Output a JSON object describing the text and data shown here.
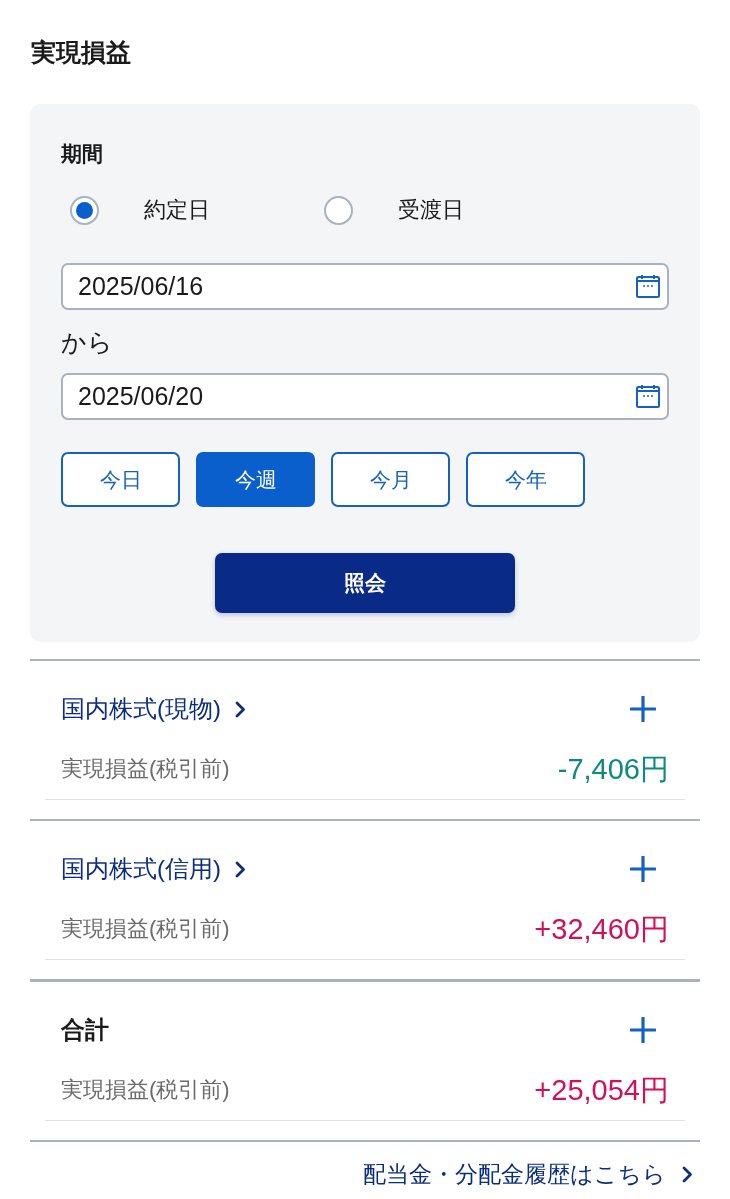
{
  "page": {
    "title": "実現損益"
  },
  "filter": {
    "period_label": "期間",
    "date_basis": [
      {
        "label": "約定日",
        "selected": true
      },
      {
        "label": "受渡日",
        "selected": false
      }
    ],
    "start_date": {
      "value": "2025/06/16"
    },
    "range_word": "から",
    "end_date": {
      "value": "2025/06/20"
    },
    "quick_ranges": [
      {
        "label": "今日",
        "selected": false
      },
      {
        "label": "今週",
        "selected": true
      },
      {
        "label": "今月",
        "selected": false
      },
      {
        "label": "今年",
        "selected": false
      }
    ],
    "submit": "照会"
  },
  "sections": [
    {
      "kind": "link",
      "title": "国内株式(現物)",
      "row_label": "実現損益(税引前)",
      "value": "-7,406円",
      "color": "#0e8a7c"
    },
    {
      "kind": "link",
      "title": "国内株式(信用)",
      "row_label": "実現損益(税引前)",
      "value": "+32,460円",
      "color": "#d0105a"
    },
    {
      "kind": "total",
      "title": "合計",
      "row_label": "実現損益(税引前)",
      "value": "+25,054円",
      "color": "#d0105a"
    }
  ],
  "footer_link": "配当金・分配金履歴はこちら"
}
